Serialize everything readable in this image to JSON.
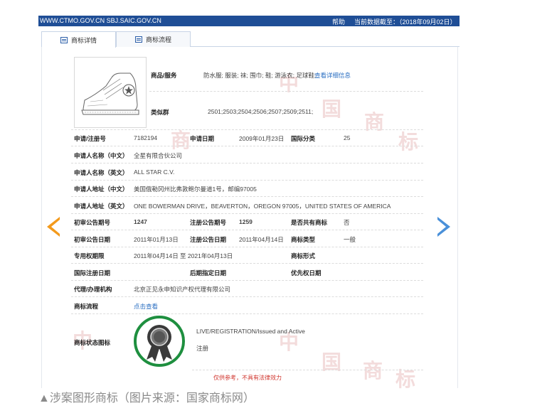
{
  "header": {
    "site": "WWW.CTMO.GOV.CN SBJ.SAIC.GOV.CN",
    "help": "帮助",
    "data_date": "当前数据截至：（2018年09月02日）"
  },
  "tabs": [
    {
      "label": "商标详情"
    },
    {
      "label": "商标流程"
    }
  ],
  "watermark": [
    "中",
    "国",
    "商",
    "标"
  ],
  "details": {
    "goods_label": "商品/服务",
    "goods_value": "防水服; 服装; 袜; 围巾; 鞋; 游泳衣; 足球鞋;",
    "goods_more": "查看详细信息",
    "group_label": "类似群",
    "group_value": "2501;2503;2504;2506;2507;2509;2511;",
    "reg_no_label": "申请/注册号",
    "reg_no": "7182194",
    "apply_date_label": "申请日期",
    "apply_date": "2009年01月23日",
    "intl_class_label": "国际分类",
    "intl_class": "25",
    "name_cn_label": "申请人名称（中文）",
    "name_cn": "全星有限合伙公司",
    "name_en_label": "申请人名称（英文）",
    "name_en": "ALL STAR C.V.",
    "addr_cn_label": "申请人地址（中文）",
    "addr_cn": "美国俄勒冈州比弗敦鲍尔曼道1号，邮编97005",
    "addr_en_label": "申请人地址（英文）",
    "addr_en": "ONE BOWERMAN DRIVE，BEAVERTON，OREGON 97005，UNITED STATES OF AMERICA",
    "prelim_no_label": "初审公告期号",
    "prelim_no": "1247",
    "reg_pub_no_label": "注册公告期号",
    "reg_pub_no": "1259",
    "shared_label": "是否共有商标",
    "shared": "否",
    "prelim_date_label": "初审公告日期",
    "prelim_date": "2011年01月13日",
    "reg_pub_date_label": "注册公告日期",
    "reg_pub_date": "2011年04月14日",
    "type_label": "商标类型",
    "type": "一般",
    "excl_label": "专用权期限",
    "excl": "2011年04月14日 至 2021年04月13日",
    "form_label": "商标形式",
    "intl_reg_date_label": "国际注册日期",
    "later_date_label": "后期指定日期",
    "priority_date_label": "优先权日期",
    "agent_label": "代理/办理机构",
    "agent": "北京正见永申知识产权代理有限公司",
    "flow_label": "商标流程",
    "flow_link": "点击查看",
    "status_label": "商标状态图标",
    "status_en": "LIVE/REGISTRATION/Issued and Active",
    "status_cn": "注册"
  },
  "disclaimer": "仅供参考，不具有法律效力",
  "caption": "▲涉案图形商标（图片来源：国家商标网）",
  "colors": {
    "header_bg": "#1f4e96",
    "link": "#2b6fc2",
    "prev_arrow": "#f39a1c",
    "next_arrow": "#4a90d9",
    "badge_ring": "#1e8f3f",
    "disclaimer": "#d0342c"
  }
}
